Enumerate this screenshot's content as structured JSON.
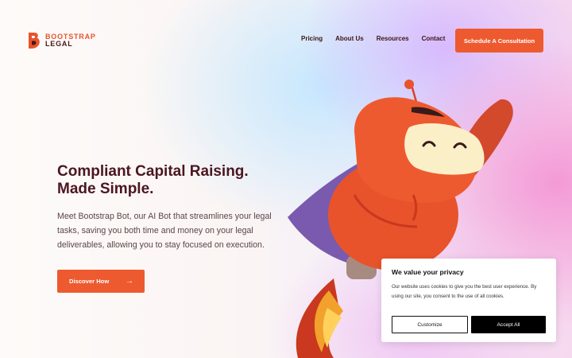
{
  "brand": {
    "line1": "BOOTSTRAP",
    "line2": "LEGAL",
    "logo_icon": "b-monogram-icon",
    "color_primary": "#ee5a2f",
    "color_dark": "#4a1620"
  },
  "nav": {
    "items": [
      {
        "label": "Pricing"
      },
      {
        "label": "About Us"
      },
      {
        "label": "Resources"
      },
      {
        "label": "Contact"
      }
    ],
    "cta_label": "Schedule A Consultation"
  },
  "hero": {
    "headline_line1": "Compliant Capital Raising.",
    "headline_line2": "Made Simple.",
    "intro": "Meet Bootstrap Bot, our AI Bot that streamlines your legal tasks, saving you both time and money on your legal deliverables, allowing you to stay focused on execution.",
    "button_label": "Discover How",
    "button_icon": "arrow-right-icon",
    "illustration": "bootstrap-bot-mascot"
  },
  "cookie_banner": {
    "title": "We value your privacy",
    "body": "Our website uses cookies to give you the best user experience. By using our site, you consent to the use of all cookies.",
    "customize_label": "Customize",
    "accept_label": "Accept All"
  }
}
